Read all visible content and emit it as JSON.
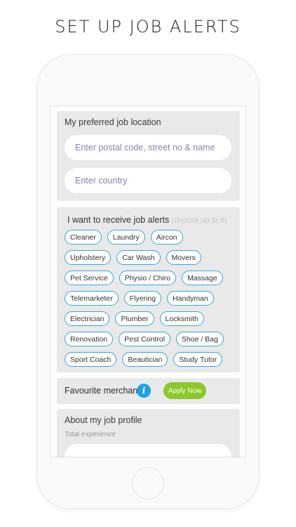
{
  "headline": "SET UP JOB ALERTS",
  "location": {
    "title": "My preferred job location",
    "postal_placeholder": "Enter postal code, street no & name",
    "country_placeholder": "Enter country"
  },
  "alerts": {
    "title": "I want to receive job alerts",
    "hint": "(choose up to 6)",
    "rows": [
      [
        "Cleaner",
        "Laundry",
        "Aircon"
      ],
      [
        "Upholstery",
        "Car Wash",
        "Movers"
      ],
      [
        "Pet Service",
        "Physio / Chiro",
        "Massage"
      ],
      [
        "Telemarketer",
        "Flyering",
        "Handyman"
      ],
      [
        "Electrician",
        "Plumber",
        "Locksmith"
      ],
      [
        "Renovation",
        "Pest Control",
        "Shoe / Bag"
      ],
      [
        "Sport Coach",
        "Beautician",
        "Study Tutor"
      ]
    ]
  },
  "merchant": {
    "label": "Favourite merchant",
    "info_icon": "info-icon",
    "apply_label": "Apply Now",
    "apply_color": "#8bc82a"
  },
  "profile": {
    "title": "About my job profile",
    "subtitle": "Total experience"
  },
  "colors": {
    "chip_border": "#33a8e0",
    "card_bg": "#e9e9e9"
  }
}
